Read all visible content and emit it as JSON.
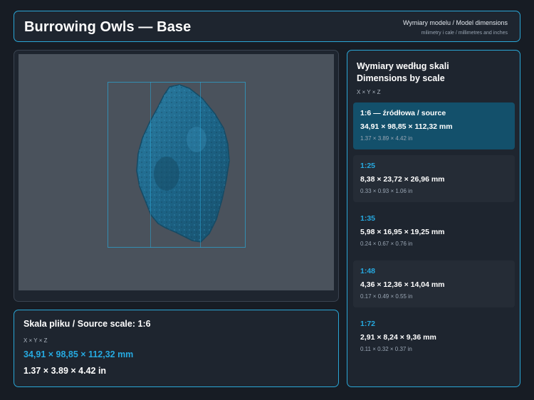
{
  "header": {
    "title": "Burrowing Owls — Base",
    "subtitle": "Wymiary modelu / Model dimensions",
    "units_note": "milimetry i cale / millimetres and inches"
  },
  "viewer": {
    "model_color": "#1e6384",
    "bbox_color": "#2aa6d6",
    "background": "#4a525c"
  },
  "source": {
    "title": "Skala pliku / Source scale: 1:6",
    "axes": "X × Y × Z",
    "mm": "34,91 × 98,85 × 112,32 mm",
    "inches": "1.37 × 3.89 × 4.42 in"
  },
  "scales_panel": {
    "title_pl": "Wymiary według skali",
    "title_en": "Dimensions by scale",
    "axes": "X × Y × Z",
    "items": [
      {
        "label": "1:6  —  źródłowa / source",
        "mm": "34,91 × 98,85 × 112,32 mm",
        "inches": "1.37 × 3.89 × 4.42 in",
        "active": true
      },
      {
        "label": "1:25",
        "mm": "8,38 × 23,72 × 26,96 mm",
        "inches": "0.33 × 0.93 × 1.06 in",
        "active": false
      },
      {
        "label": "1:35",
        "mm": "5,98 × 16,95 × 19,25 mm",
        "inches": "0.24 × 0.67 × 0.76 in",
        "active": false
      },
      {
        "label": "1:48",
        "mm": "4,36 × 12,36 × 14,04 mm",
        "inches": "0.17 × 0.49 × 0.55 in",
        "active": false
      },
      {
        "label": "1:72",
        "mm": "2,91 × 8,24 × 9,36 mm",
        "inches": "0.11 × 0.32 × 0.37 in",
        "active": false
      }
    ]
  }
}
